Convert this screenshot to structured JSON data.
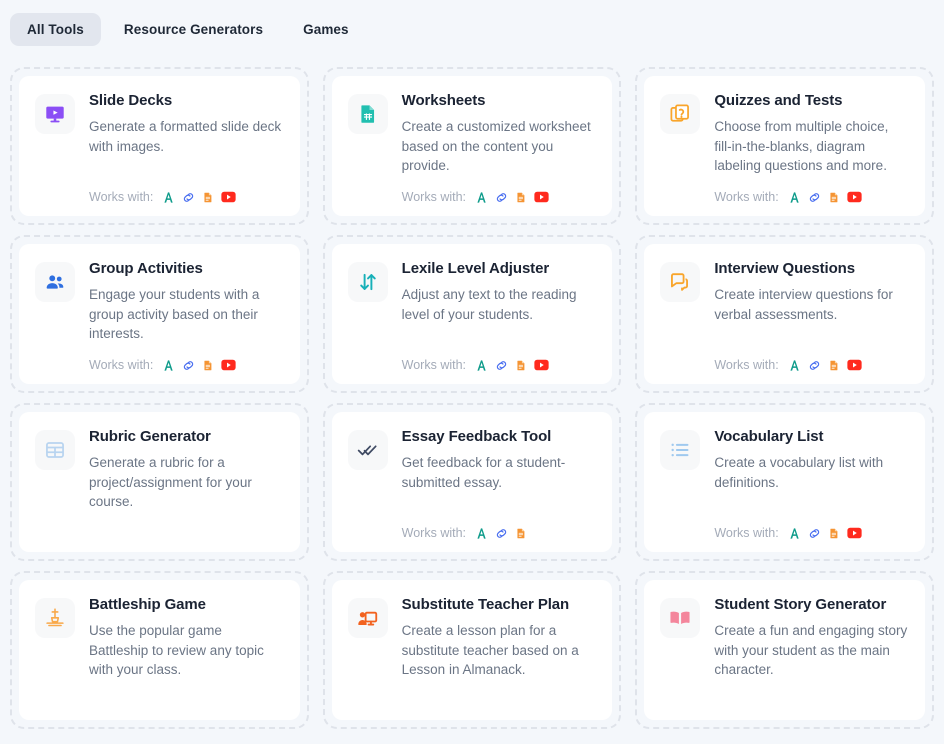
{
  "tabs": [
    {
      "label": "All Tools",
      "active": true
    },
    {
      "label": "Resource Generators",
      "active": false
    },
    {
      "label": "Games",
      "active": false
    }
  ],
  "works_with_label": "Works with:",
  "integration_icons": {
    "text_a": {
      "name": "text-format-a-icon",
      "color": "#0d9b8a"
    },
    "link": {
      "name": "link-icon",
      "color": "#4a6ff0"
    },
    "document": {
      "name": "document-icon",
      "color": "#f59433"
    },
    "youtube": {
      "name": "youtube-icon",
      "color": "#ff2a1e"
    }
  },
  "colors": {
    "page_background": "#f4f7fb",
    "card_background": "#ffffff",
    "slot_border": "#dfe3ea",
    "active_tab_background": "#e2e6ee",
    "title_text": "#1b2333",
    "description_text": "#6b7585",
    "works_label_text": "#a4abb8"
  },
  "tools": [
    {
      "title": "Slide Decks",
      "description": "Generate a formatted slide deck with images.",
      "icon": "slide-deck-icon",
      "icon_color": "#8b4ef5",
      "works_with": [
        "text_a",
        "link",
        "document",
        "youtube"
      ]
    },
    {
      "title": "Worksheets",
      "description": "Create a customized worksheet based on the content you provide.",
      "icon": "worksheet-document-icon",
      "icon_color": "#21bfb0",
      "works_with": [
        "text_a",
        "link",
        "document",
        "youtube"
      ]
    },
    {
      "title": "Quizzes and Tests",
      "description": "Choose from multiple choice, fill-in-the-blanks, diagram labeling questions and more.",
      "icon": "quiz-cards-icon",
      "icon_color": "#f9a52b",
      "works_with": [
        "text_a",
        "link",
        "document",
        "youtube"
      ]
    },
    {
      "title": "Group Activities",
      "description": "Engage your students with a group activity based on their interests.",
      "icon": "people-group-icon",
      "icon_color": "#2f6fe0",
      "works_with": [
        "text_a",
        "link",
        "document",
        "youtube"
      ]
    },
    {
      "title": "Lexile Level Adjuster",
      "description": "Adjust any text to the reading level of your students.",
      "icon": "up-down-arrows-icon",
      "icon_color": "#17b0b8",
      "works_with": [
        "text_a",
        "link",
        "document",
        "youtube"
      ]
    },
    {
      "title": "Interview Questions",
      "description": "Create interview questions for verbal assessments.",
      "icon": "chat-bubbles-icon",
      "icon_color": "#f9a52b",
      "works_with": [
        "text_a",
        "link",
        "document",
        "youtube"
      ]
    },
    {
      "title": "Rubric Generator",
      "description": "Generate a rubric for a project/assignment for your course.",
      "icon": "table-grid-icon",
      "icon_color": "#b8d4f0",
      "works_with": []
    },
    {
      "title": "Essay Feedback Tool",
      "description": "Get feedback for a student-submitted essay.",
      "icon": "double-check-icon",
      "icon_color": "#3f4a63",
      "works_with": [
        "text_a",
        "link",
        "document"
      ]
    },
    {
      "title": "Vocabulary List",
      "description": "Create a vocabulary list with definitions.",
      "icon": "bullet-list-icon",
      "icon_color": "#9fc9ef",
      "works_with": [
        "text_a",
        "link",
        "document",
        "youtube"
      ]
    },
    {
      "title": "Battleship Game",
      "description": "Use the popular game Battleship to review any topic with your class.",
      "icon": "sailboat-icon",
      "icon_color": "#f9a94a",
      "works_with": []
    },
    {
      "title": "Substitute Teacher Plan",
      "description": "Create a lesson plan for a substitute teacher based on a Lesson in Almanack.",
      "icon": "teacher-board-icon",
      "icon_color": "#f2621f",
      "works_with": []
    },
    {
      "title": "Student Story Generator",
      "description": "Create a fun and engaging story with your student as the main character.",
      "icon": "open-book-icon",
      "icon_color": "#f4869c",
      "works_with": []
    }
  ]
}
